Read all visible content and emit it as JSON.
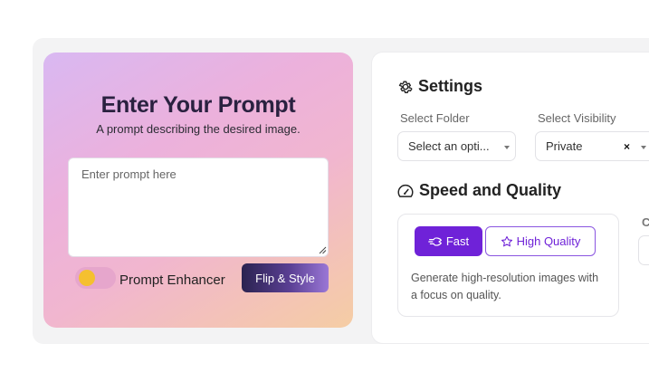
{
  "prompt_panel": {
    "title": "Enter Your Prompt",
    "subtitle": "A prompt describing the desired image.",
    "placeholder": "Enter prompt here",
    "value": "",
    "enhancer_label": "Prompt Enhancer",
    "enhancer_enabled": false,
    "action_label": "Flip & Style"
  },
  "settings": {
    "title": "Settings",
    "folder": {
      "label": "Select Folder",
      "value": "Select an opti..."
    },
    "visibility": {
      "label": "Select Visibility",
      "value": "Private",
      "clear_symbol": "×"
    }
  },
  "speed_quality": {
    "title": "Speed and Quality",
    "options": [
      {
        "label": "Fast",
        "selected": true
      },
      {
        "label": "High Quality",
        "selected": false
      }
    ],
    "description": "Generate high-resolution images with a focus on quality.",
    "cut_off_label": "C"
  },
  "colors": {
    "accent": "#6f22d8",
    "toggle_knob": "#f5c030"
  },
  "icons": {
    "settings": "gear-icon",
    "speed": "speedometer-icon",
    "fast": "fast-icon",
    "high_quality": "star-icon"
  }
}
